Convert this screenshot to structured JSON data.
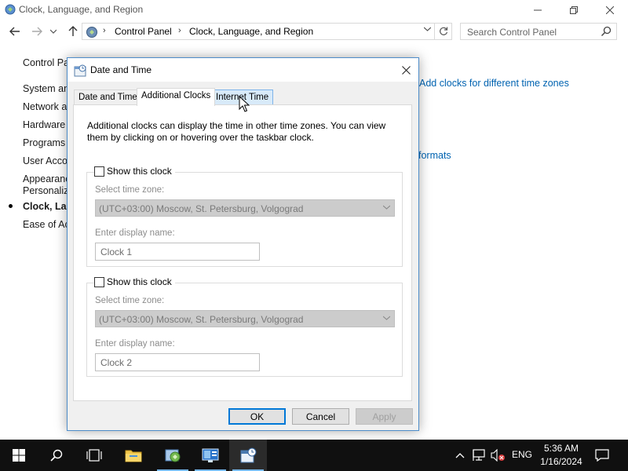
{
  "control_panel": {
    "title": "Clock, Language, and Region",
    "breadcrumbs": [
      "Control Panel",
      "Clock, Language, and Region"
    ],
    "search_placeholder": "Search Control Panel",
    "sidebar": [
      {
        "label": "Control Pa",
        "active": false
      },
      {
        "label": "System an",
        "active": false
      },
      {
        "label": "Network a",
        "active": false
      },
      {
        "label": "Hardware a",
        "active": false
      },
      {
        "label": "Programs",
        "active": false
      },
      {
        "label": "User Accou",
        "active": false
      },
      {
        "label": "Appearanc",
        "active": false
      },
      {
        "label": "Personaliz",
        "active": false
      },
      {
        "label": "Clock, Lan",
        "active": true
      },
      {
        "label": "Ease of Ac",
        "active": false
      }
    ],
    "links": {
      "add_clocks": "Add clocks for different time zones",
      "formats": "formats"
    }
  },
  "dialog": {
    "title": "Date and Time",
    "tabs": [
      {
        "label": "Date and Time"
      },
      {
        "label": "Additional Clocks"
      },
      {
        "label": "Internet Time"
      }
    ],
    "description": "Additional clocks can display the time in other time zones. You can view them by clicking on or hovering over the taskbar clock.",
    "clocks": [
      {
        "show_label": "Show this clock",
        "timezone_label": "Select time zone:",
        "timezone_value": "(UTC+03:00) Moscow, St. Petersburg, Volgograd",
        "name_label": "Enter display name:",
        "name_value": "Clock 1"
      },
      {
        "show_label": "Show this clock",
        "timezone_label": "Select time zone:",
        "timezone_value": "(UTC+03:00) Moscow, St. Petersburg, Volgograd",
        "name_label": "Enter display name:",
        "name_value": "Clock 2"
      }
    ],
    "buttons": {
      "ok": "OK",
      "cancel": "Cancel",
      "apply": "Apply"
    }
  },
  "taskbar": {
    "language": "ENG",
    "time": "5:36 AM",
    "date": "1/16/2024"
  },
  "colors": {
    "accent": "#0078d7",
    "link": "#0063b1",
    "taskbar": "#101010"
  }
}
